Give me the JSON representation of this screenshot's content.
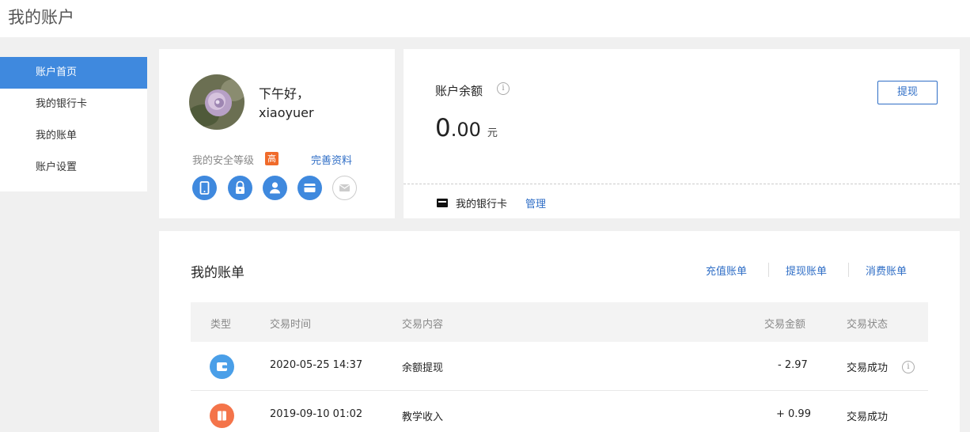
{
  "page": {
    "title": "我的账户"
  },
  "sidebar": {
    "items": [
      {
        "label": "账户首页",
        "active": true
      },
      {
        "label": "我的银行卡"
      },
      {
        "label": "我的账单"
      },
      {
        "label": "账户设置"
      }
    ]
  },
  "profile": {
    "greeting": "下午好，",
    "username": "xiaoyuer",
    "security_label": "我的安全等级",
    "security_level": "高",
    "complete_link": "完善资料",
    "security_icons": [
      "phone-icon",
      "lock-icon",
      "user-icon",
      "bank-card-icon",
      "mail-icon"
    ]
  },
  "balance": {
    "label": "账户余额",
    "amount_int": "0",
    "amount_dec": ".00",
    "unit": "元",
    "withdraw_button": "提现",
    "bank_card_label": "我的银行卡",
    "manage_link": "管理"
  },
  "bills": {
    "title": "我的账单",
    "tabs": [
      "充值账单",
      "提现账单",
      "消费账单"
    ],
    "columns": [
      "类型",
      "交易时间",
      "交易内容",
      "交易金额",
      "交易状态"
    ],
    "rows": [
      {
        "icon": "wallet-icon",
        "time": "2020-05-25 14:37",
        "content": "余额提现",
        "amount": "- 2.97",
        "status": "交易成功"
      },
      {
        "icon": "book-icon",
        "time": "2019-09-10 01:02",
        "content": "教学收入",
        "amount": "+ 0.99",
        "status": "交易成功"
      }
    ]
  },
  "colors": {
    "accent": "#3f89de",
    "link": "#2f6ec6",
    "badge": "#f06b2b",
    "wallet_icon": "#4a9fe8",
    "book_icon": "#f4744a"
  }
}
